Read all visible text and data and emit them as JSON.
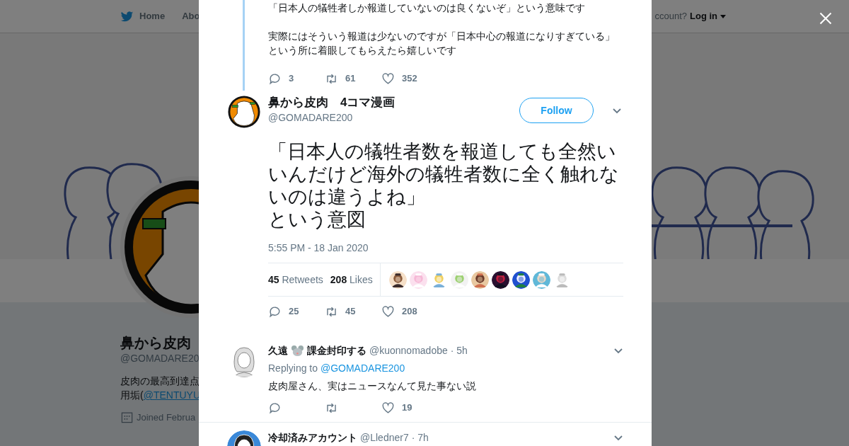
{
  "nav": {
    "items": [
      {
        "label": "Home",
        "kind": "home"
      },
      {
        "label": "Abo",
        "kind": "plain"
      }
    ],
    "account_prompt": "ccount?",
    "login": "Log in"
  },
  "banner": {
    "kind": "picture"
  },
  "profile": {
    "name": "鼻から皮肉",
    "handle": "@GOMADARE20",
    "bio": [
      {
        "text": "皮肉の最高到達点"
      },
      {
        "text": "用垢(",
        "link": "@TENTUYU"
      }
    ],
    "joined": "Joined Februa"
  },
  "thread_context": {
    "paragraphs": [
      [
        "「日本人の犠牲者しか報道していないのは良くないぞ」という意味です"
      ],
      [
        "実際にはそういう報道は少ないのですが「日本中心の報道になりすぎている」",
        "という所に着眼してもらえたら嬉しいです"
      ]
    ],
    "actions": [
      {
        "kind": "reply",
        "count": "3"
      },
      {
        "kind": "retweet",
        "count": "61"
      },
      {
        "kind": "like",
        "count": "352"
      }
    ]
  },
  "tweet": {
    "name": "鼻から皮肉　4コマ漫画",
    "handle": "@GOMADARE200",
    "follow": "Follow",
    "paragraphs": [
      "「日本人の犠牲者数を報道しても全然いいんだけど海外の犠牲者数に全く触れないのは違うよね」",
      "という意図"
    ],
    "timestamp": "5:55 PM - 18 Jan 2020",
    "stats": [
      {
        "count": "45",
        "label": "Retweets"
      },
      {
        "count": "208",
        "label": "Likes"
      }
    ],
    "liker_avatars": [
      {
        "kind": "picture"
      },
      {
        "kind": "picture"
      },
      {
        "kind": "picture"
      },
      {
        "kind": "picture"
      },
      {
        "kind": "picture"
      },
      {
        "kind": "picture"
      },
      {
        "kind": "picture"
      },
      {
        "kind": "picture"
      },
      {
        "kind": "picture"
      }
    ],
    "actions": [
      {
        "kind": "reply",
        "count": "25"
      },
      {
        "kind": "retweet",
        "count": "45"
      },
      {
        "kind": "like",
        "count": "208"
      }
    ]
  },
  "replies": [
    {
      "name": [
        {
          "kind": "text",
          "text": "久遠"
        },
        {
          "kind": "emoji"
        },
        {
          "kind": "text",
          "text": "課金封印する"
        }
      ],
      "handle": "@kuonnomadobe",
      "time": "· 5h",
      "replying_to": "Replying to",
      "reply_target": "@GOMADARE200",
      "text": "皮肉屋さん、実はニュースなんて見た事ない説",
      "actions": [
        {
          "kind": "reply"
        },
        {
          "kind": "retweet"
        },
        {
          "kind": "like",
          "count": "19"
        }
      ]
    },
    {
      "name": [
        {
          "kind": "text",
          "text": "冷却済みアカウント"
        }
      ],
      "handle": "@Lledner7",
      "time": "· 7h"
    }
  ]
}
